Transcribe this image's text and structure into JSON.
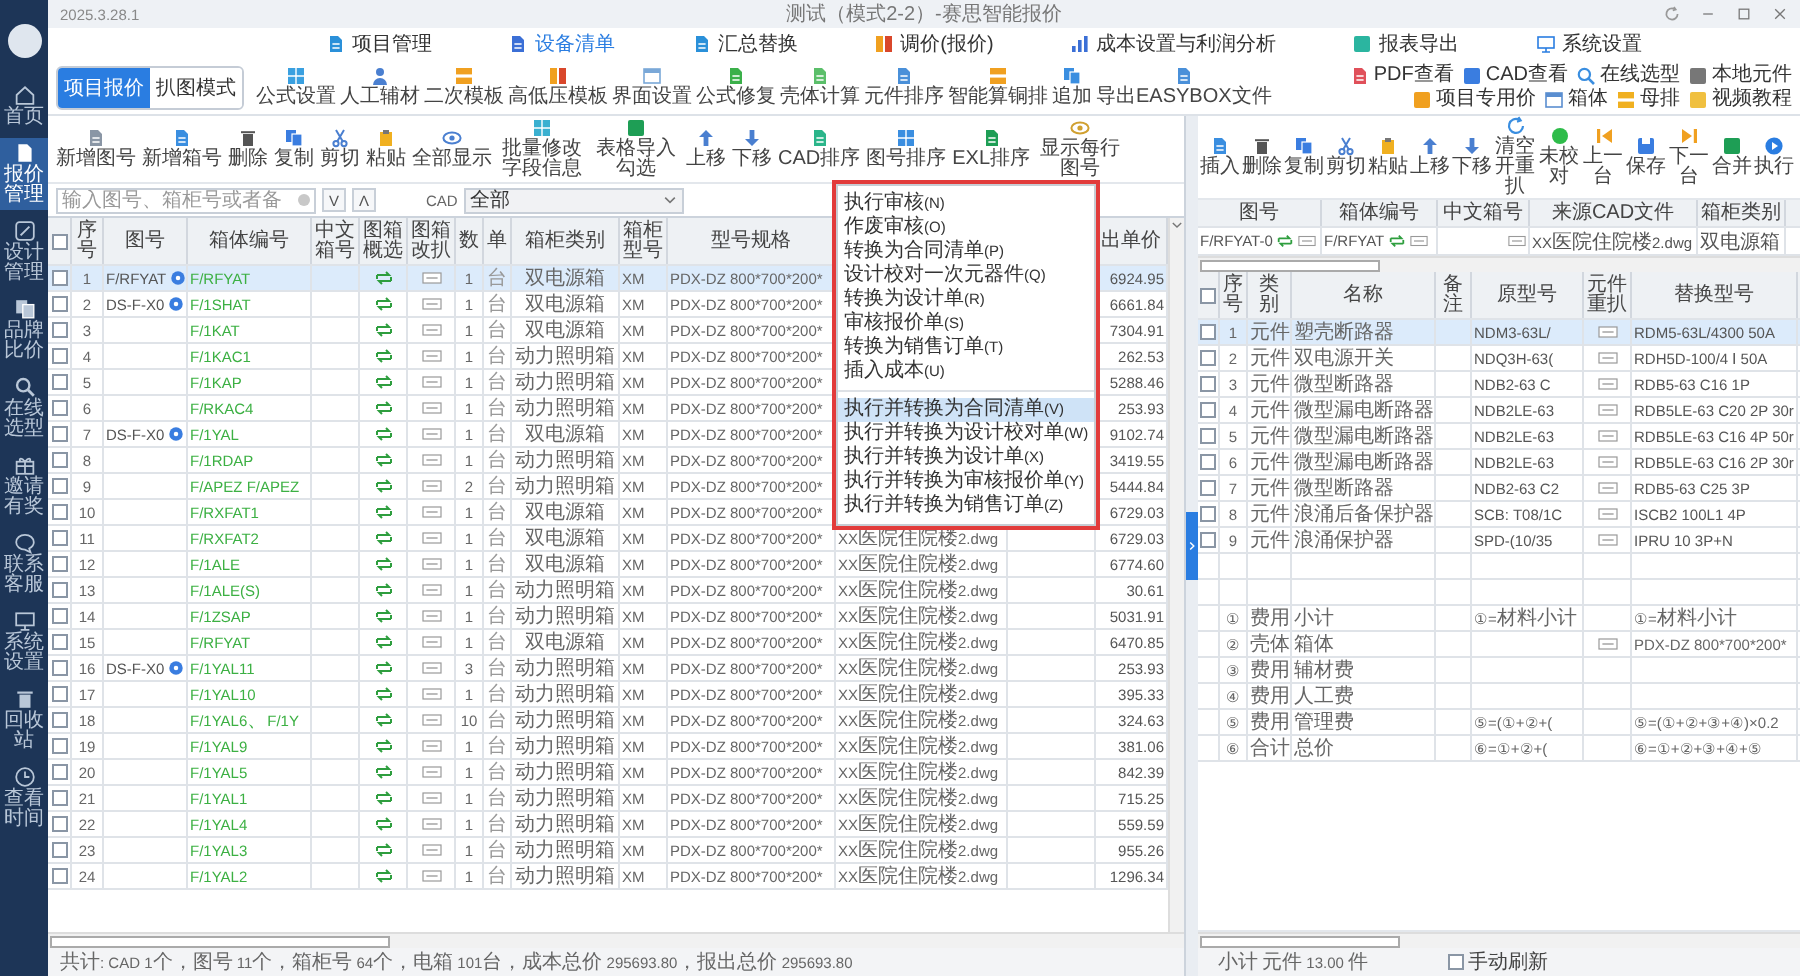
{
  "app": {
    "version": "2025.3.28.1",
    "title": "测试（模式2-2）-赛思智能报价"
  },
  "sidebar": {
    "items": [
      {
        "label": "首页",
        "selected": false
      },
      {
        "label": "报价管理",
        "selected": true
      },
      {
        "label": "设计管理",
        "selected": false
      },
      {
        "label": "品牌比价",
        "selected": false
      },
      {
        "label": "在线选型",
        "selected": false
      },
      {
        "label": "邀请有奖",
        "selected": false
      },
      {
        "label": "联系客服",
        "selected": false
      },
      {
        "label": "系统设置",
        "selected": false
      },
      {
        "label": "回收站",
        "selected": false
      },
      {
        "label": "查看时间",
        "selected": false
      }
    ]
  },
  "nav_tabs": [
    {
      "label": "项目管理",
      "selected": false
    },
    {
      "label": "设备清单",
      "selected": true
    },
    {
      "label": "汇总替换",
      "selected": false
    },
    {
      "label": "调价(报价)",
      "selected": false
    },
    {
      "label": "成本设置与利润分析",
      "selected": false
    },
    {
      "label": "报表导出",
      "selected": false
    },
    {
      "label": "系统设置",
      "selected": false
    }
  ],
  "mode_toggle": [
    {
      "label": "项目报价",
      "selected": true
    },
    {
      "label": "扒图模式",
      "selected": false
    }
  ],
  "main_toolbar": [
    "公式设置",
    "人工辅材",
    "二次模板",
    "高低压模板",
    "界面设置",
    "公式修复",
    "壳体计算",
    "元件排序",
    "智能算铜排",
    "追加",
    "导出EASYBOX文件"
  ],
  "quick_links": [
    "PDF查看",
    "CAD查看",
    "在线选型",
    "本地元件",
    "项目专用价",
    "箱体",
    "母排",
    "视频教程"
  ],
  "list_toolbar": [
    "新增图号",
    "新增箱号",
    "删除",
    "复制",
    "剪切",
    "粘贴",
    "全部显示",
    "批量修改字段信息",
    "表格导入勾选",
    "上移",
    "下移",
    "CAD排序",
    "图号排序",
    "EXL排序",
    "显示每行图号"
  ],
  "search": {
    "placeholder": "输入图号、箱柜号或者备",
    "next": "V",
    "prev": "Λ",
    "cad_label": "CAD",
    "cad_value": "全部"
  },
  "boxes_table": {
    "all_checked": false,
    "columns": [
      "序号",
      "图号",
      "箱体编号",
      "中文箱号",
      "图箱概选",
      "图箱改扒",
      "数",
      "单",
      "箱柜类别",
      "箱柜型号",
      "型号规格",
      "出单价"
    ],
    "rows": [
      {
        "seq": "1",
        "drawing_no": "F/RFYAT",
        "box_no": "F/RFYAT",
        "qty": "1",
        "unit": "台",
        "category": "双电源箱",
        "model": "XM",
        "spec": "PDX-DZ 800*700*200*",
        "price": "6924.95",
        "checked": false,
        "selected": true
      },
      {
        "seq": "2",
        "drawing_no": "DS-F-X0",
        "box_no": "F/1SHAT",
        "qty": "1",
        "unit": "台",
        "category": "双电源箱",
        "model": "XM",
        "spec": "PDX-DZ 800*700*200*",
        "price": "6661.84",
        "checked": false,
        "selected": false
      },
      {
        "seq": "3",
        "box_no": "F/1KAT",
        "qty": "1",
        "unit": "台",
        "category": "双电源箱",
        "model": "XM",
        "spec": "PDX-DZ 800*700*200*",
        "price": "7304.91",
        "checked": false,
        "selected": false
      },
      {
        "seq": "4",
        "box_no": "F/1KAC1",
        "qty": "1",
        "unit": "台",
        "category": "动力照明箱",
        "model": "XM",
        "spec": "PDX-DZ 800*700*200*",
        "price": "262.53",
        "checked": false,
        "selected": false
      },
      {
        "seq": "5",
        "box_no": "F/1KAP",
        "qty": "1",
        "unit": "台",
        "category": "动力照明箱",
        "model": "XM",
        "spec": "PDX-DZ 800*700*200*",
        "price": "5288.46",
        "checked": false,
        "selected": false
      },
      {
        "seq": "6",
        "box_no": "F/RKAC4",
        "qty": "1",
        "unit": "台",
        "category": "动力照明箱",
        "model": "XM",
        "spec": "PDX-DZ 800*700*200*",
        "price": "253.93",
        "checked": false,
        "selected": false
      },
      {
        "seq": "7",
        "drawing_no": "DS-F-X0",
        "box_no": "F/1YAL",
        "qty": "1",
        "unit": "台",
        "category": "双电源箱",
        "model": "XM",
        "spec": "PDX-DZ 800*700*200*",
        "price": "9102.74",
        "checked": false,
        "selected": false
      },
      {
        "seq": "8",
        "box_no": "F/1RDAP",
        "qty": "1",
        "unit": "台",
        "category": "动力照明箱",
        "model": "XM",
        "spec": "PDX-DZ 800*700*200*",
        "price": "3419.55",
        "checked": false,
        "selected": false
      },
      {
        "seq": "9",
        "box_no": "F/APEZ F/APEZ",
        "qty": "2",
        "unit": "台",
        "category": "动力照明箱",
        "model": "XM",
        "spec": "PDX-DZ 800*700*200*",
        "price": "5444.84",
        "checked": false,
        "selected": false
      },
      {
        "seq": "10",
        "box_no": "F/RXFAT1",
        "qty": "1",
        "unit": "台",
        "category": "双电源箱",
        "model": "XM",
        "spec": "PDX-DZ 800*700*200*",
        "price": "6729.03",
        "checked": false,
        "selected": false
      },
      {
        "seq": "11",
        "box_no": "F/RXFAT2",
        "qty": "1",
        "unit": "台",
        "category": "双电源箱",
        "model": "XM",
        "spec": "PDX-DZ 800*700*200*",
        "cad_file": "XX医院住院楼2.dwg",
        "price": "6729.03",
        "checked": false,
        "selected": false
      },
      {
        "seq": "12",
        "box_no": "F/1ALE",
        "qty": "1",
        "unit": "台",
        "category": "双电源箱",
        "model": "XM",
        "spec": "PDX-DZ 800*700*200*",
        "cad_file": "XX医院住院楼2.dwg",
        "price": "6774.60",
        "checked": false,
        "selected": false
      },
      {
        "seq": "13",
        "box_no": "F/1ALE(S)",
        "qty": "1",
        "unit": "台",
        "category": "动力照明箱",
        "model": "XM",
        "spec": "PDX-DZ 800*700*200*",
        "cad_file": "XX医院住院楼2.dwg",
        "price": "30.61",
        "checked": false,
        "selected": false
      },
      {
        "seq": "14",
        "box_no": "F/1ZSAP",
        "qty": "1",
        "unit": "台",
        "category": "动力照明箱",
        "model": "XM",
        "spec": "PDX-DZ 800*700*200*",
        "cad_file": "XX医院住院楼2.dwg",
        "price": "5031.91",
        "checked": false,
        "selected": false
      },
      {
        "seq": "15",
        "box_no": "F/RFYAT",
        "qty": "1",
        "unit": "台",
        "category": "双电源箱",
        "model": "XM",
        "spec": "PDX-DZ 800*700*200*",
        "cad_file": "XX医院住院楼2.dwg",
        "price": "6470.85",
        "checked": false,
        "selected": false
      },
      {
        "seq": "16",
        "drawing_no": "DS-F-X0",
        "box_no": "F/1YAL11",
        "qty": "3",
        "unit": "台",
        "category": "动力照明箱",
        "model": "XM",
        "spec": "PDX-DZ 800*700*200*",
        "cad_file": "XX医院住院楼2.dwg",
        "price": "253.93",
        "checked": false,
        "selected": false
      },
      {
        "seq": "17",
        "box_no": "F/1YAL10",
        "qty": "1",
        "unit": "台",
        "category": "动力照明箱",
        "model": "XM",
        "spec": "PDX-DZ 800*700*200*",
        "cad_file": "XX医院住院楼2.dwg",
        "price": "395.33",
        "checked": false,
        "selected": false
      },
      {
        "seq": "18",
        "box_no": "F/1YAL6、F/1Y",
        "qty": "10",
        "unit": "台",
        "category": "动力照明箱",
        "model": "XM",
        "spec": "PDX-DZ 800*700*200*",
        "cad_file": "XX医院住院楼2.dwg",
        "price": "324.63",
        "checked": false,
        "selected": false
      },
      {
        "seq": "19",
        "box_no": "F/1YAL9",
        "qty": "1",
        "unit": "台",
        "category": "动力照明箱",
        "model": "XM",
        "spec": "PDX-DZ 800*700*200*",
        "cad_file": "XX医院住院楼2.dwg",
        "price": "381.06",
        "checked": false,
        "selected": false
      },
      {
        "seq": "20",
        "box_no": "F/1YAL5",
        "qty": "1",
        "unit": "台",
        "category": "动力照明箱",
        "model": "XM",
        "spec": "PDX-DZ 800*700*200*",
        "cad_file": "XX医院住院楼2.dwg",
        "price": "842.39",
        "checked": false,
        "selected": false
      },
      {
        "seq": "21",
        "box_no": "F/1YAL1",
        "qty": "1",
        "unit": "台",
        "category": "动力照明箱",
        "model": "XM",
        "spec": "PDX-DZ 800*700*200*",
        "cad_file": "XX医院住院楼2.dwg",
        "price": "715.25",
        "checked": false,
        "selected": false
      },
      {
        "seq": "22",
        "box_no": "F/1YAL4",
        "qty": "1",
        "unit": "台",
        "category": "动力照明箱",
        "model": "XM",
        "spec": "PDX-DZ 800*700*200*",
        "cad_file": "XX医院住院楼2.dwg",
        "price": "559.59",
        "checked": false,
        "selected": false
      },
      {
        "seq": "23",
        "box_no": "F/1YAL3",
        "qty": "1",
        "unit": "台",
        "category": "动力照明箱",
        "model": "XM",
        "spec": "PDX-DZ 800*700*200*",
        "cad_file": "XX医院住院楼2.dwg",
        "price": "955.26",
        "checked": false,
        "selected": false
      },
      {
        "seq": "24",
        "box_no": "F/1YAL2",
        "qty": "1",
        "unit": "台",
        "category": "动力照明箱",
        "model": "XM",
        "spec": "PDX-DZ 800*700*200*",
        "cad_file": "XX医院住院楼2.dwg",
        "price": "1296.34",
        "checked": false,
        "selected": false
      }
    ]
  },
  "context_menu": {
    "groups": [
      [
        {
          "label": "执行审核(N)",
          "selected": false
        },
        {
          "label": "作废审核(O)",
          "selected": false
        },
        {
          "label": "转换为合同清单(P)",
          "selected": false
        },
        {
          "label": "设计校对一次元器件(Q)",
          "selected": false
        },
        {
          "label": "转换为设计单(R)",
          "selected": false
        },
        {
          "label": "审核报价单(S)",
          "selected": false
        },
        {
          "label": "转换为销售订单(T)",
          "selected": false
        },
        {
          "label": "插入成本(U)",
          "selected": false
        }
      ],
      [
        {
          "label": "执行并转换为合同清单(V)",
          "selected": true
        },
        {
          "label": "执行并转换为设计校对单(W)",
          "selected": false
        },
        {
          "label": "执行并转换为设计单(X)",
          "selected": false
        },
        {
          "label": "执行并转换为审核报价单(Y)",
          "selected": false
        },
        {
          "label": "执行并转换为销售订单(Z)",
          "selected": false
        }
      ]
    ]
  },
  "status_bar": "共计: CAD 1个，图号 11个，箱柜号 64个，电箱 101台，成本总价 295693.80，报出总价 295693.80",
  "detail": {
    "toolbar": [
      "插入",
      "删除",
      "复制",
      "剪切",
      "粘贴",
      "上移",
      "下移",
      "清空开重扒",
      "未校对",
      "上一台",
      "保存",
      "下一台",
      "合并",
      "执行"
    ],
    "header_table": {
      "columns": [
        "图号",
        "箱体编号",
        "中文箱号",
        "来源CAD文件",
        "箱柜类别"
      ],
      "row": {
        "drawing_no": "F/RFYAT-0",
        "box_no": "F/RFYAT",
        "cad_file": "XX医院住院楼2.dwg",
        "category": "双电源箱"
      }
    },
    "parts_table": {
      "all_checked": false,
      "columns": [
        "序号",
        "类别",
        "名称",
        "备注",
        "原型号",
        "元件重扒",
        "替换型号"
      ],
      "rows": [
        {
          "kind": "part",
          "seq": "1",
          "type": "元件",
          "name": "塑壳断路器",
          "orig": "NDM3-63L/",
          "replacement": "RDM5-63L/4300 50A",
          "checked": false,
          "selected": true
        },
        {
          "kind": "part",
          "seq": "2",
          "type": "元件",
          "name": "双电源开关",
          "orig": "NDQ3H-63(",
          "replacement": "RDH5D-100/4 Ⅰ 50A",
          "checked": false,
          "selected": false
        },
        {
          "kind": "part",
          "seq": "3",
          "type": "元件",
          "name": "微型断路器",
          "orig": "NDB2-63 C",
          "replacement": "RDB5-63 C16 1P",
          "checked": false,
          "selected": false
        },
        {
          "kind": "part",
          "seq": "4",
          "type": "元件",
          "name": "微型漏电断路器",
          "orig": "NDB2LE-63",
          "replacement": "RDB5LE-63 C20 2P 30r",
          "checked": false,
          "selected": false
        },
        {
          "kind": "part",
          "seq": "5",
          "type": "元件",
          "name": "微型漏电断路器",
          "orig": "NDB2LE-63",
          "replacement": "RDB5LE-63 C16 4P 50r",
          "checked": false,
          "selected": false
        },
        {
          "kind": "part",
          "seq": "6",
          "type": "元件",
          "name": "微型漏电断路器",
          "orig": "NDB2LE-63",
          "replacement": "RDB5LE-63 C16 2P 30r",
          "checked": false,
          "selected": false
        },
        {
          "kind": "part",
          "seq": "7",
          "type": "元件",
          "name": "微型断路器",
          "orig": "NDB2-63 C2",
          "replacement": "RDB5-63 C25 3P",
          "checked": false,
          "selected": false
        },
        {
          "kind": "part",
          "seq": "8",
          "type": "元件",
          "name": "浪涌后备保护器",
          "orig": "SCB: T08/1C",
          "replacement": "ISCB2 100L1 4P",
          "checked": false,
          "selected": false
        },
        {
          "kind": "part",
          "seq": "9",
          "type": "元件",
          "name": "浪涌保护器",
          "orig": "SPD-(10/35",
          "replacement": "IPRU 10 3P+N",
          "checked": false,
          "selected": false
        },
        {
          "kind": "blank"
        },
        {
          "kind": "blank"
        },
        {
          "kind": "summary",
          "seq": "①",
          "type": "费用",
          "name": "小计",
          "orig": "①=材料小计",
          "replacement": "①=材料小计",
          "rescan": false
        },
        {
          "kind": "summary",
          "seq": "②",
          "type": "壳体",
          "name": "箱体",
          "replacement": "PDX-DZ 800*700*200*",
          "rescan": true
        },
        {
          "kind": "summary",
          "seq": "③",
          "type": "费用",
          "name": "辅材费",
          "rescan": false
        },
        {
          "kind": "summary",
          "seq": "④",
          "type": "费用",
          "name": "人工费",
          "rescan": false
        },
        {
          "kind": "summary",
          "seq": "⑤",
          "type": "费用",
          "name": "管理费",
          "orig": "⑤=(①+②+(",
          "replacement": "⑤=(①+②+③+④)×0.2",
          "rescan": false
        },
        {
          "kind": "summary",
          "seq": "⑥",
          "type": "合计",
          "name": "总价",
          "orig": "⑥=①+②+(",
          "replacement": "⑥=①+②+③+④+⑤",
          "rescan": false
        }
      ]
    },
    "footer": {
      "subtotal": "小计 元件 13.00 件",
      "manual_refresh": {
        "label": "手动刷新",
        "checked": false
      }
    }
  }
}
